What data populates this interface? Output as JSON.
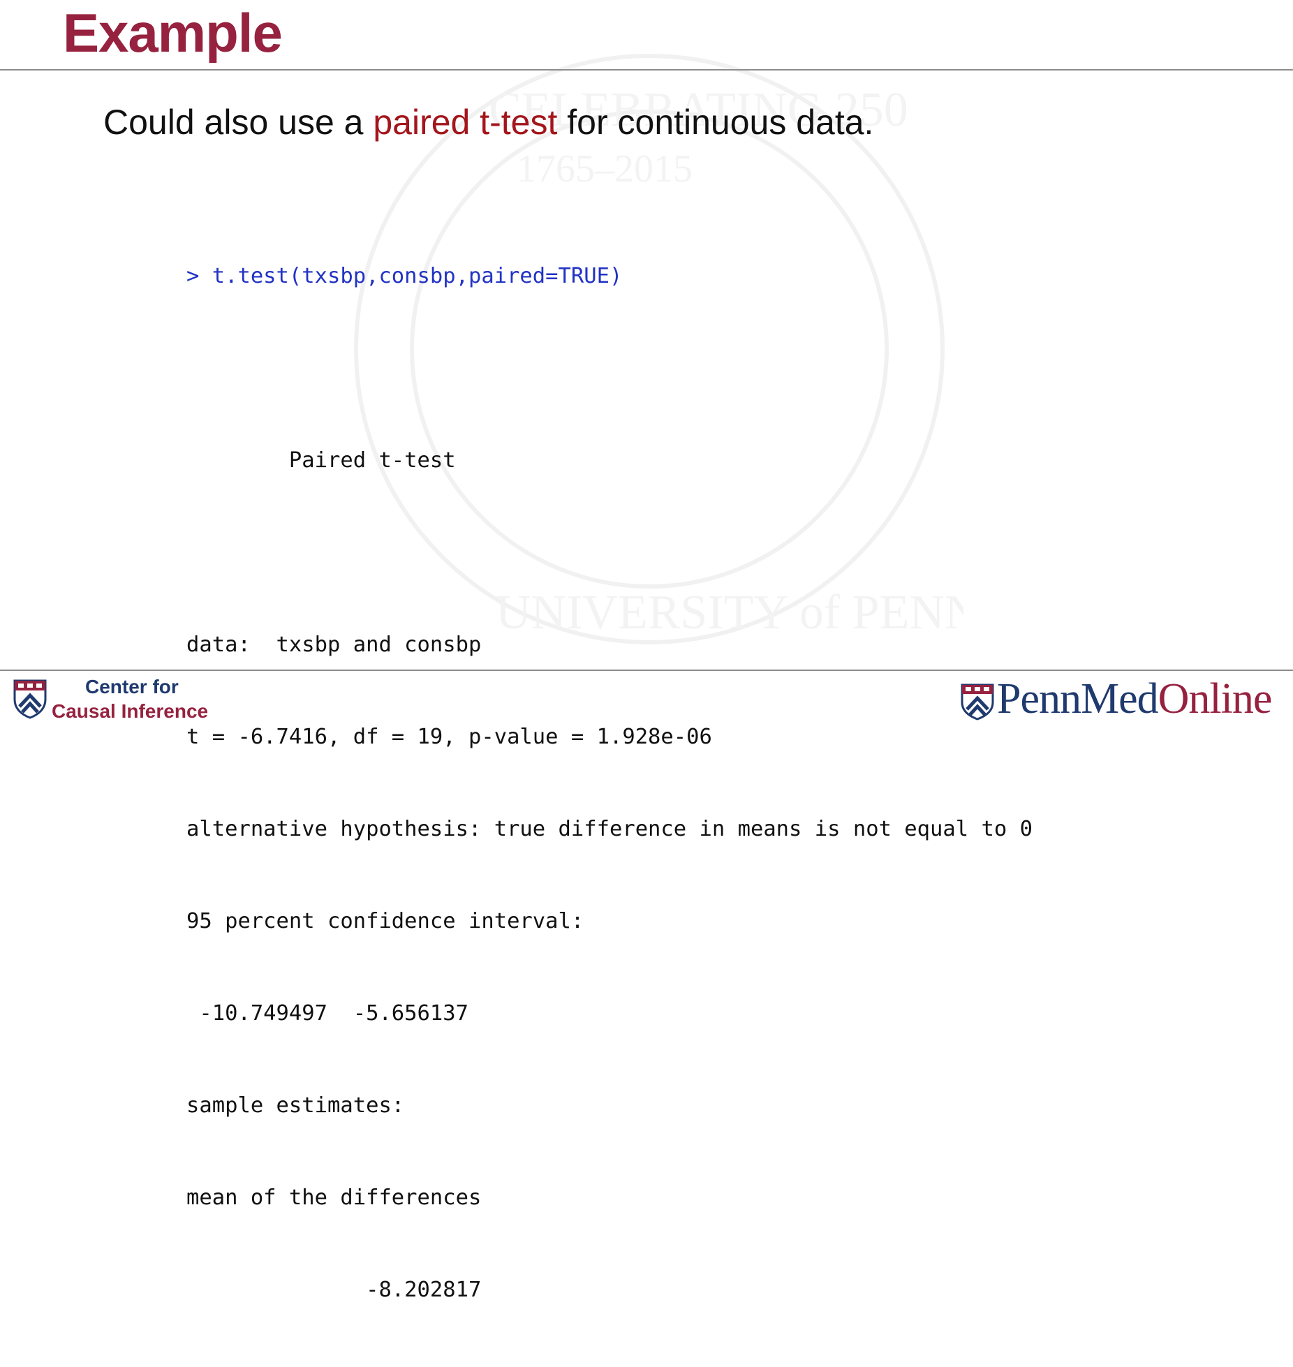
{
  "slide": {
    "title": "Example",
    "subtitle_before": "Could also use a ",
    "subtitle_highlight": "paired t-test",
    "subtitle_after": " for continuous data."
  },
  "code": {
    "command": "> t.test(txsbp,consbp,paired=TRUE)",
    "lines": [
      "",
      "        Paired t-test",
      "",
      "data:  txsbp and consbp",
      "t = -6.7416, df = 19, p-value = 1.928e-06",
      "alternative hypothesis: true difference in means is not equal to 0",
      "95 percent confidence interval:",
      " -10.749497  -5.656137",
      "sample estimates:",
      "mean of the differences",
      "              -8.202817"
    ]
  },
  "footer": {
    "center_line1": "Center for",
    "center_line2": "Causal Inference",
    "brand_penn": "Penn",
    "brand_med": "Med",
    "brand_online": "Online"
  },
  "colors": {
    "title": "#96223f",
    "highlight": "#a4151c",
    "command": "#2233c4",
    "navy": "#1f3a6e"
  },
  "icons": {
    "left_logo": "penn-shield-icon",
    "right_logo": "penn-shield-icon"
  }
}
